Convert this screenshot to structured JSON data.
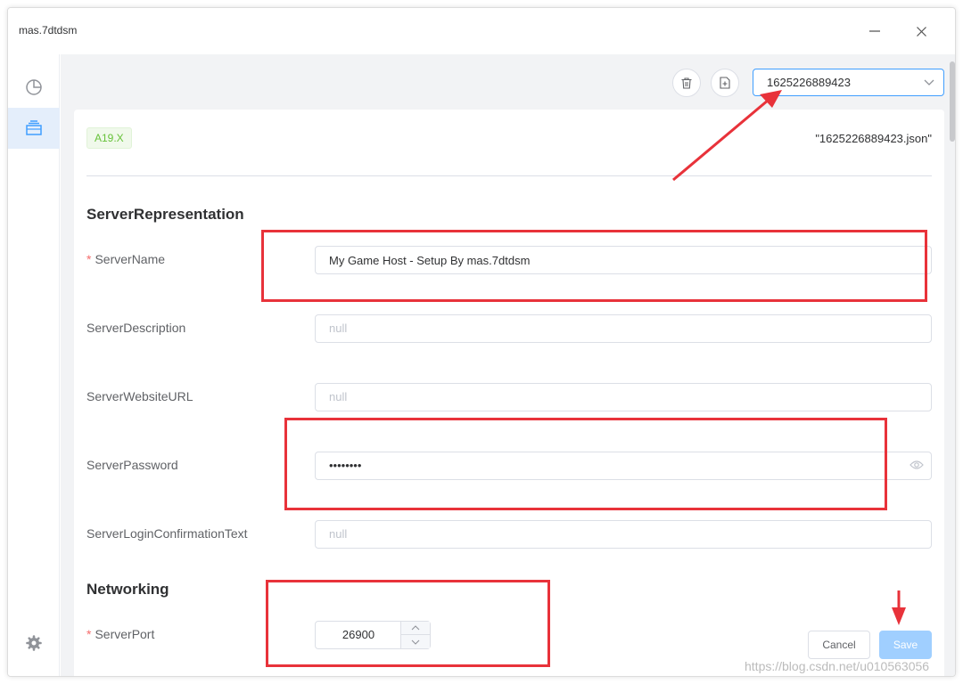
{
  "window": {
    "title": "mas.7dtdsm"
  },
  "toolbar": {
    "selected_config": "1625226889423"
  },
  "card": {
    "version_tag": "A19.X",
    "filename": "\"1625226889423.json\""
  },
  "sections": {
    "representation": "ServerRepresentation",
    "networking": "Networking"
  },
  "fields": {
    "server_name": {
      "label": "ServerName",
      "value": "My Game Host - Setup By mas.7dtdsm"
    },
    "server_description": {
      "label": "ServerDescription",
      "placeholder": "null"
    },
    "server_website_url": {
      "label": "ServerWebsiteURL",
      "placeholder": "null"
    },
    "server_password": {
      "label": "ServerPassword",
      "value": "••••••••"
    },
    "server_login_confirmation": {
      "label": "ServerLoginConfirmationText",
      "placeholder": "null"
    },
    "server_port": {
      "label": "ServerPort",
      "value": "26900"
    }
  },
  "actions": {
    "cancel": "Cancel",
    "save": "Save"
  },
  "required_marker": "*",
  "watermark": "https://blog.csdn.net/u010563056",
  "colors": {
    "accent": "#409eff",
    "annotation_red": "#e8323a",
    "tag_green": "#67c23a"
  },
  "icons": {
    "sidebar": [
      "dashboard-icon",
      "server-icon",
      "settings-icon"
    ],
    "toolbar": [
      "trash-icon",
      "new-file-icon",
      "chevron-down-icon"
    ]
  }
}
